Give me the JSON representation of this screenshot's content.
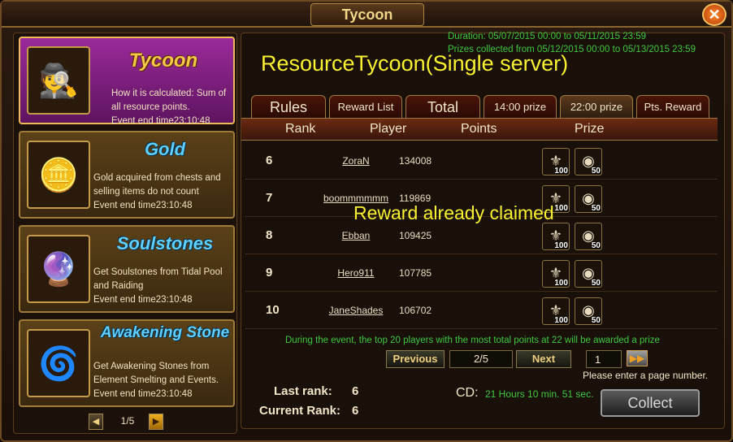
{
  "window": {
    "title": "Tycoon",
    "close_label": "✕"
  },
  "sidebar": {
    "events": [
      {
        "name": "Tycoon",
        "desc": "How it is calculated: Sum of all resource points.",
        "end": "Event end time23:10:48",
        "icon": "🕵",
        "active": true
      },
      {
        "name": "Gold",
        "desc": "Gold acquired from chests and selling items do not count",
        "end": "Event end time23:10:48",
        "icon": "🪙",
        "active": false
      },
      {
        "name": "Soulstones",
        "desc": "Get Soulstones from Tidal Pool and Raiding",
        "end": "Event end time23:10:48",
        "icon": "🔮",
        "active": false
      },
      {
        "name": "Awakening Stone",
        "desc": "Get Awakening Stones from Element Smelting and Events.",
        "end": "Event end time23:10:48",
        "icon": "🌀",
        "active": false
      }
    ],
    "pager": {
      "text": "1/5",
      "prev": "◀",
      "next": "▶"
    }
  },
  "main": {
    "duration": "Duration: 05/07/2015 00:00 to 05/11/2015 23:59",
    "prizes_collected": "Prizes collected from 05/12/2015 00:00 to 05/13/2015 23:59",
    "event_title": "ResourceTycoon(Single server)",
    "tabs": [
      "Rules",
      "Reward List",
      "Total",
      "14:00 prize",
      "22:00 prize",
      "Pts. Reward"
    ],
    "active_tab": "22:00 prize",
    "columns": [
      "Rank",
      "Player",
      "Points",
      "Prize"
    ],
    "rows": [
      {
        "rank": "6",
        "player": "ZoraN",
        "points": "134008",
        "prize1": "100",
        "prize2": "50"
      },
      {
        "rank": "7",
        "player": "boommmmmm",
        "points": "119869",
        "prize1": "100",
        "prize2": "50"
      },
      {
        "rank": "8",
        "player": "Ebban",
        "points": "109425",
        "prize1": "100",
        "prize2": "50"
      },
      {
        "rank": "9",
        "player": "Hero911",
        "points": "107785",
        "prize1": "100",
        "prize2": "50"
      },
      {
        "rank": "10",
        "player": "JaneShades",
        "points": "106702",
        "prize1": "100",
        "prize2": "50"
      }
    ],
    "claimed_text": "Reward already claimed",
    "notice": "During the event, the top 20 players with the most total points at 22 will be awarded a prize",
    "pager": {
      "previous": "Previous",
      "info": "2/5",
      "next": "Next",
      "input_value": "1",
      "go": "▶▶"
    },
    "hint": "Please enter a page number.",
    "last_rank_label": "Last rank:",
    "last_rank_value": "6",
    "current_rank_label": "Current Rank:",
    "current_rank_value": "6",
    "cd_label": "CD:",
    "cd_value": "21 Hours 10 min. 51 sec.",
    "collect": "Collect"
  }
}
